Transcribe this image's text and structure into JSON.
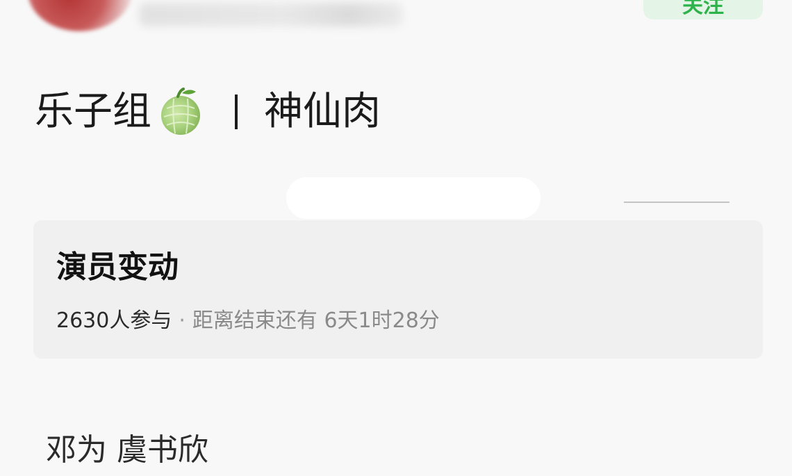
{
  "header": {
    "follow_label": "关注",
    "accent_color": "#2eb34c"
  },
  "post": {
    "title_left": "乐子组",
    "title_emoji": "melon-icon",
    "title_separator": "|",
    "title_right": "神仙肉",
    "body": "邓为 虞书欣"
  },
  "poll": {
    "title": "演员变动",
    "participants": "2630人参与",
    "dot": "·",
    "remaining": "距离结束还有 6天1时28分"
  }
}
